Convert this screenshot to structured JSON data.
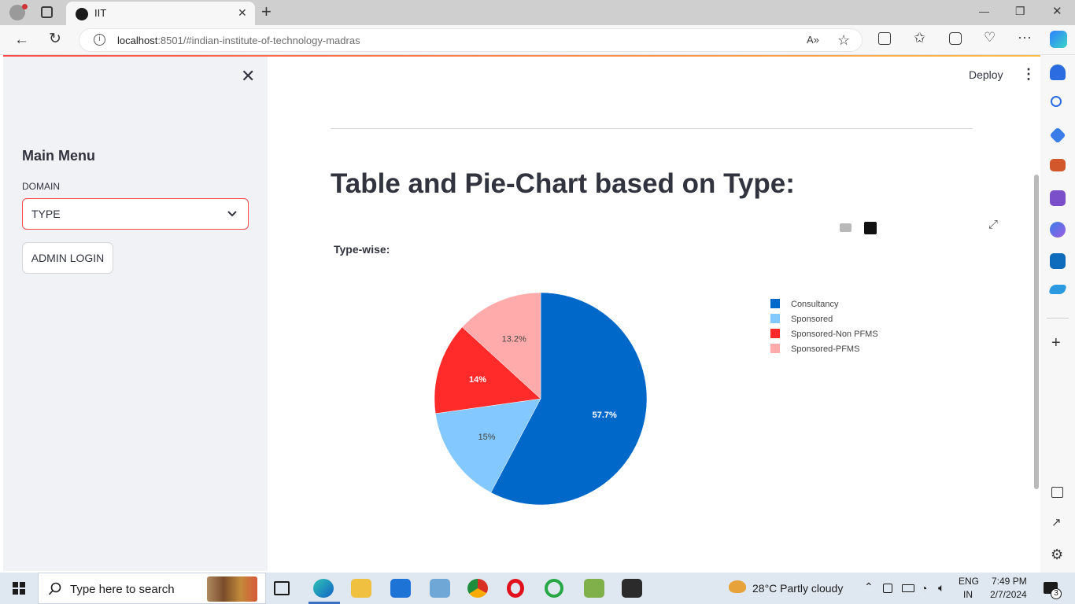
{
  "browser": {
    "tab_title": "IIT",
    "url_host": "localhost",
    "url_rest": ":8501/#indian-institute-of-technology-madras",
    "new_tab": "+",
    "window_controls": {
      "minimize": "—",
      "maximize": "❐",
      "close": "✕"
    }
  },
  "sidebar": {
    "close_glyph": "✕",
    "menu_title": "Main Menu",
    "domain_label": "DOMAIN",
    "domain_value": "TYPE",
    "admin_button": "ADMIN LOGIN"
  },
  "header": {
    "deploy": "Deploy",
    "menu_glyph": "⋮"
  },
  "main": {
    "title": "Table and Pie-Chart based on Type:",
    "chart_subtitle": "Type-wise:"
  },
  "chart_data": {
    "type": "pie",
    "title": "Type-wise:",
    "legend_position": "right",
    "slices": [
      {
        "label": "Consultancy",
        "value": 57.7,
        "text": "57.7%",
        "color": "#0068c9"
      },
      {
        "label": "Sponsored",
        "value": 15,
        "text": "15%",
        "color": "#83c9ff"
      },
      {
        "label": "Sponsored-Non PFMS",
        "value": 14,
        "text": "14%",
        "color": "#ff2b2b"
      },
      {
        "label": "Sponsored-PFMS",
        "value": 13.2,
        "text": "13.2%",
        "color": "#ffabab"
      }
    ]
  },
  "taskbar": {
    "search_placeholder": "Type here to search",
    "weather": "28°C  Partly cloudy",
    "lang_top": "ENG",
    "lang_bottom": "IN",
    "time": "7:49 PM",
    "date": "2/7/2024",
    "notification_count": "3"
  }
}
